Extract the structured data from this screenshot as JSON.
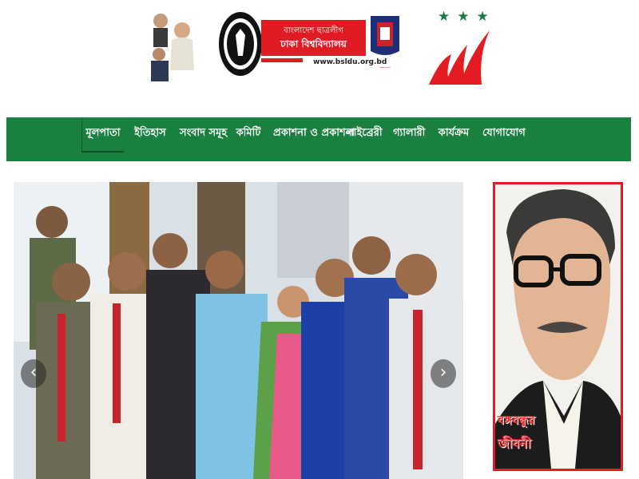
{
  "header": {
    "banner_line1": "বাংলাদেশ ছাত্রলীগ",
    "banner_line2": "ঢাকা বিশ্ববিদ্যালয়",
    "website": "www.bsldu.org.bd",
    "stars": "★★★"
  },
  "nav": {
    "items": [
      {
        "label": "মূলপাতা"
      },
      {
        "label": "ইতিহাস"
      },
      {
        "label": "সংবাদ সমূহ"
      },
      {
        "label": "কমিটি"
      },
      {
        "label": "প্রকাশনা ও প্রকাশনা"
      },
      {
        "label": "লাইব্রেরী"
      },
      {
        "label": "গ্যালারী"
      },
      {
        "label": "কার্যক্রম"
      },
      {
        "label": "যোগাযোগ"
      }
    ],
    "active_index": 0
  },
  "slider": {
    "prev_icon": "‹",
    "next_icon": "›"
  },
  "side": {
    "caption_line1": "বঙ্গবন্ধুর",
    "caption_line2": "জীবনী"
  },
  "colors": {
    "nav_bg": "#1a8040",
    "brand_red": "#e01b24",
    "star_green": "#1a7a3c"
  }
}
